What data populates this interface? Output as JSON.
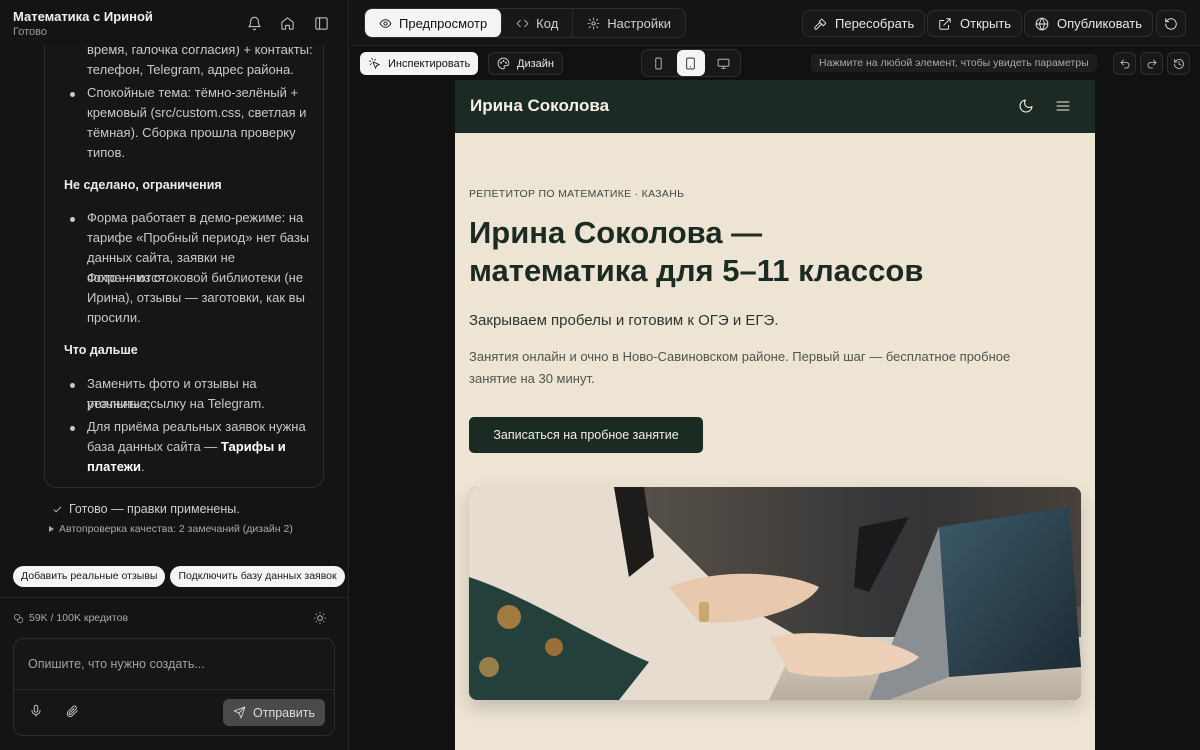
{
  "app": {
    "project_title": "Математика с Ириной",
    "project_status": "Готово"
  },
  "chat": {
    "message_lines": [
      "время, галочка согласия) + контакты:",
      "телефон, Telegram, адрес района."
    ],
    "bullet_theme": [
      "Спокойные тема: тёмно-зелёный +",
      "кремовый (src/custom.css, светлая и",
      "тёмная). Сборка прошла проверку",
      "типов."
    ],
    "heading_limits": "Не сделано, ограничения",
    "bullet_demo": [
      "Форма работает в демо-режиме: на",
      "тарифе «Пробный период» нет базы",
      "данных сайта, заявки не сохраняются.",
      "Фото — из стоковой библиотеки (не",
      "Ирина), отзывы — заготовки, как вы",
      "просили."
    ],
    "heading_next": "Что дальше",
    "bullet_replace": [
      "Заменить фото и отзывы на реальные,",
      "уточнить ссылку на Telegram."
    ],
    "bullet_db_line1": "Для приёма реальных заявок нужна",
    "bullet_db_line2_prefix": "база данных сайта — ",
    "bullet_db_link1": "Тарифы и",
    "bullet_db_link2": "платежи",
    "bullet_db_suffix": ".",
    "done_text": "Готово — правки применены.",
    "qa_text": "Автопроверка качества: 2 замечаний (дизайн 2)"
  },
  "suggestions": [
    "Добавить реальные отзывы",
    "Подключить базу данных заявок"
  ],
  "credits": "59K / 100K кредитов",
  "composer": {
    "placeholder": "Опишите, что нужно создать...",
    "send_label": "Отправить"
  },
  "toolbar": {
    "tabs": [
      "Предпросмотр",
      "Код",
      "Настройки"
    ],
    "rebuild": "Пересобрать",
    "open": "Открыть",
    "publish": "Опубликовать"
  },
  "inspect": {
    "inspect_label": "Инспектировать",
    "design_label": "Дизайн",
    "hint": "Нажмите на любой элемент, чтобы увидеть параметры"
  },
  "site": {
    "brand": "Ирина Соколова",
    "eyebrow": "РЕПЕТИТОР ПО МАТЕМАТИКЕ · КАЗАНЬ",
    "title_line1": "Ирина Соколова —",
    "title_line2": "математика для 5–11 классов",
    "lead": "Закрываем пробелы и готовим к ОГЭ и ЕГЭ.",
    "body_line1": "Занятия онлайн и очно в Ново-Савиновском районе. Первый шаг — бесплатное пробное",
    "body_line2": "занятие на 30 минут.",
    "cta": "Записаться на пробное занятие",
    "colors": {
      "dark_green": "#1b2a22",
      "cream": "#ede4d3"
    }
  }
}
